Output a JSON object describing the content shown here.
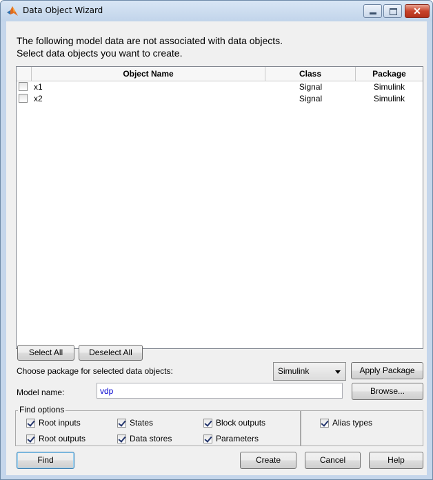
{
  "window": {
    "title": "Data Object Wizard"
  },
  "intro": {
    "line1": "The following model data are not associated with data objects.",
    "line2": "Select data objects you want to create."
  },
  "table": {
    "columns": [
      "",
      "Object Name",
      "Class",
      "Package"
    ],
    "rows": [
      {
        "checked": false,
        "name": "x1",
        "class": "Signal",
        "package": "Simulink"
      },
      {
        "checked": false,
        "name": "x2",
        "class": "Signal",
        "package": "Simulink"
      }
    ]
  },
  "selection_buttons": {
    "select_all": "Select All",
    "deselect_all": "Deselect All"
  },
  "package": {
    "label": "Choose package for selected data objects:",
    "selected": "Simulink",
    "apply_label": "Apply Package"
  },
  "model": {
    "label": "Model name:",
    "value": "vdp",
    "browse_label": "Browse..."
  },
  "find_options": {
    "legend": "Find options",
    "options": [
      {
        "label": "Root inputs",
        "checked": true
      },
      {
        "label": "States",
        "checked": true
      },
      {
        "label": "Block outputs",
        "checked": true
      },
      {
        "label": "Alias types",
        "checked": true
      },
      {
        "label": "Root outputs",
        "checked": true
      },
      {
        "label": "Data stores",
        "checked": true
      },
      {
        "label": "Parameters",
        "checked": true
      }
    ]
  },
  "footer": {
    "find": "Find",
    "create": "Create",
    "cancel": "Cancel",
    "help": "Help"
  },
  "colors": {
    "window_frame": "#c5d6eb",
    "dialog_bg": "#f0f0f0",
    "model_name_text": "#0000d0",
    "close_button": "#c8432b"
  }
}
